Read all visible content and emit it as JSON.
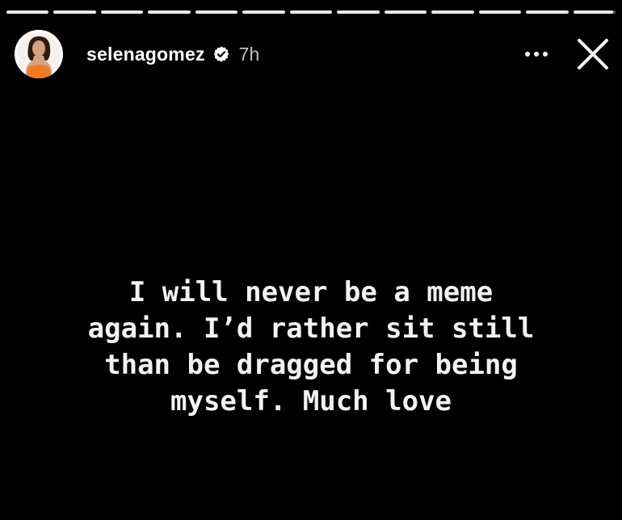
{
  "story": {
    "segments": [
      {
        "fill": 1.0
      },
      {
        "fill": 1.0
      },
      {
        "fill": 1.0
      },
      {
        "fill": 1.0
      },
      {
        "fill": 1.0
      },
      {
        "fill": 1.0
      },
      {
        "fill": 1.0
      },
      {
        "fill": 1.0
      },
      {
        "fill": 1.0
      },
      {
        "fill": 1.0
      },
      {
        "fill": 1.0
      },
      {
        "fill": 1.0
      },
      {
        "fill": 0.95
      }
    ],
    "header": {
      "username": "selenagomez",
      "time": "7h",
      "verified_icon": "verified-badge-icon",
      "more_icon": "more-options-icon",
      "close_icon": "close-icon"
    },
    "text_lines": [
      "I will never be a meme",
      "again. I’d rather sit still",
      "than be dragged for being",
      "myself. Much love"
    ]
  },
  "colors": {
    "background": "#000000",
    "text": "#ffffff",
    "time": "#bfbfbf",
    "progress_filled": "#e8e8e8",
    "progress_empty": "#595959"
  }
}
